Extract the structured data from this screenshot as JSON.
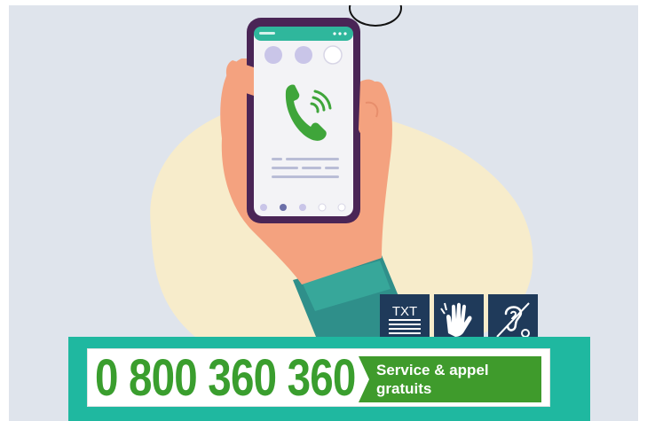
{
  "phone_number": "0 800 360 360",
  "service": {
    "line1": "Service & appel",
    "line2": "gratuits"
  },
  "accessibility": {
    "text_relay_label": "TXT",
    "icons": [
      "text-relay-icon",
      "sign-language-icon",
      "hearing-loop-icon"
    ]
  },
  "colors": {
    "background": "#dfe4ec",
    "blob": "#f7eccb",
    "banner": "#1fb8a0",
    "number_green": "#3a9e2e",
    "tag_green": "#3f9b2c",
    "icon_navy": "#1f3a5a",
    "phone_frame": "#4a2556",
    "call_icon": "#3fa53a"
  }
}
